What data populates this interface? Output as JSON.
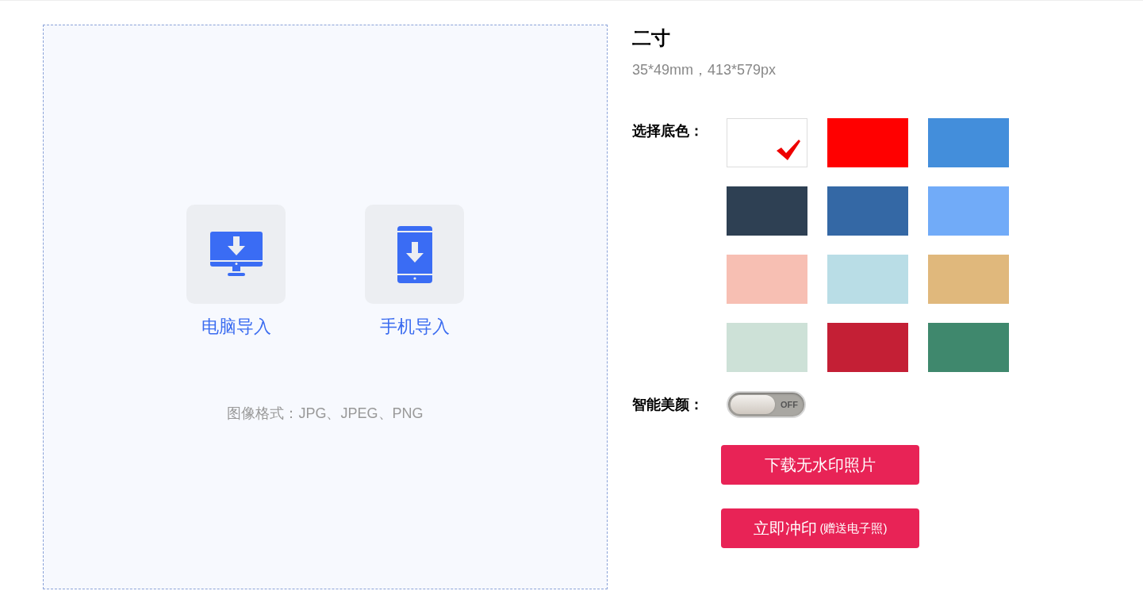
{
  "upload": {
    "sources": [
      {
        "kind": "computer",
        "label": "电脑导入"
      },
      {
        "kind": "phone",
        "label": "手机导入"
      }
    ],
    "formats": "图像格式：JPG、JPEG、PNG"
  },
  "size": {
    "title": "二寸",
    "dimensions": "35*49mm，413*579px"
  },
  "background": {
    "label": "选择底色：",
    "swatches": [
      {
        "color": "#ffffff",
        "selected": true
      },
      {
        "color": "#ff0000",
        "selected": false
      },
      {
        "color": "#438edb",
        "selected": false
      },
      {
        "color": "#2e4053",
        "selected": false
      },
      {
        "color": "#3468a5",
        "selected": false
      },
      {
        "color": "#71abf8",
        "selected": false
      },
      {
        "color": "#f7bfb3",
        "selected": false
      },
      {
        "color": "#b9dde6",
        "selected": false
      },
      {
        "color": "#e0b87c",
        "selected": false
      },
      {
        "color": "#cde1d7",
        "selected": false
      },
      {
        "color": "#c41f35",
        "selected": false
      },
      {
        "color": "#3f886d",
        "selected": false
      }
    ]
  },
  "beauty": {
    "label": "智能美颜：",
    "on": false,
    "state_text": "OFF"
  },
  "buttons": [
    {
      "label": "下载无水印照片"
    },
    {
      "label": "立即冲印",
      "note": "(赠送电子照)"
    }
  ]
}
